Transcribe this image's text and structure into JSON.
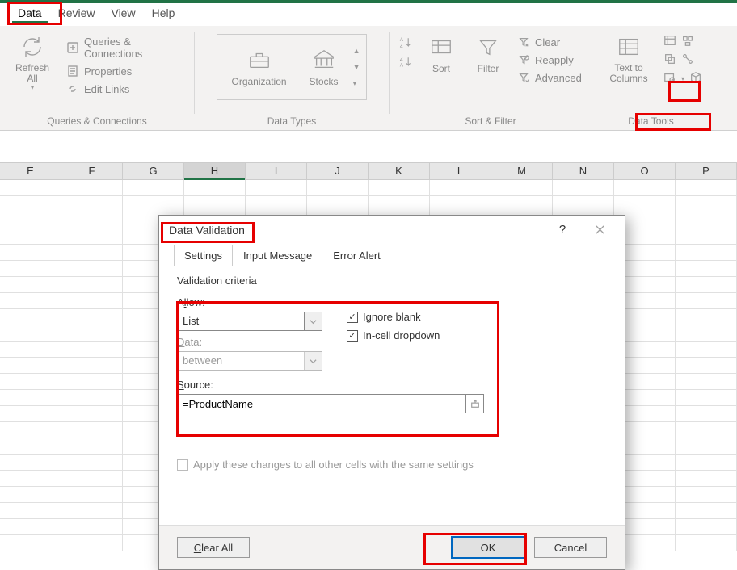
{
  "menu": {
    "items": [
      "Data",
      "Review",
      "View",
      "Help"
    ],
    "active": "Data"
  },
  "ribbon": {
    "group_queries": {
      "refresh": "Refresh All",
      "queries_conn": "Queries & Connections",
      "properties": "Properties",
      "edit_links": "Edit Links",
      "label": "Queries & Connections"
    },
    "group_datatypes": {
      "organization": "Organization",
      "stocks": "Stocks",
      "label": "Data Types"
    },
    "group_sortfilter": {
      "sort": "Sort",
      "filter": "Filter",
      "clear": "Clear",
      "reapply": "Reapply",
      "advanced": "Advanced",
      "label": "Sort & Filter"
    },
    "group_datatools": {
      "text_to_columns": "Text to Columns",
      "label": "Data Tools"
    }
  },
  "columns": [
    "E",
    "F",
    "G",
    "H",
    "I",
    "J",
    "K",
    "L",
    "M",
    "N",
    "O",
    "P"
  ],
  "dialog": {
    "title": "Data Validation",
    "tabs": {
      "settings": "Settings",
      "input_message": "Input Message",
      "error_alert": "Error Alert"
    },
    "criteria_label": "Validation criteria",
    "allow_label_pre": "A",
    "allow_label_uk": "l",
    "allow_label_post": "low:",
    "allow_value": "List",
    "data_label_pre": "",
    "data_label_uk": "D",
    "data_label_post": "ata:",
    "data_value": "between",
    "ignore_blank_pre": "Ignore ",
    "ignore_blank_uk": "b",
    "ignore_blank_post": "lank",
    "incell_pre": "",
    "incell_uk": "I",
    "incell_post": "n-cell dropdown",
    "source_label_pre": "",
    "source_label_uk": "S",
    "source_label_post": "ource:",
    "source_value": "=ProductName",
    "apply_pre": "A",
    "apply_uk": "p",
    "apply_post": "ply these changes to all other cells with the same settings",
    "clear_all_pre": "",
    "clear_all_uk": "C",
    "clear_all_post": "lear All",
    "ok": "OK",
    "cancel": "Cancel"
  }
}
